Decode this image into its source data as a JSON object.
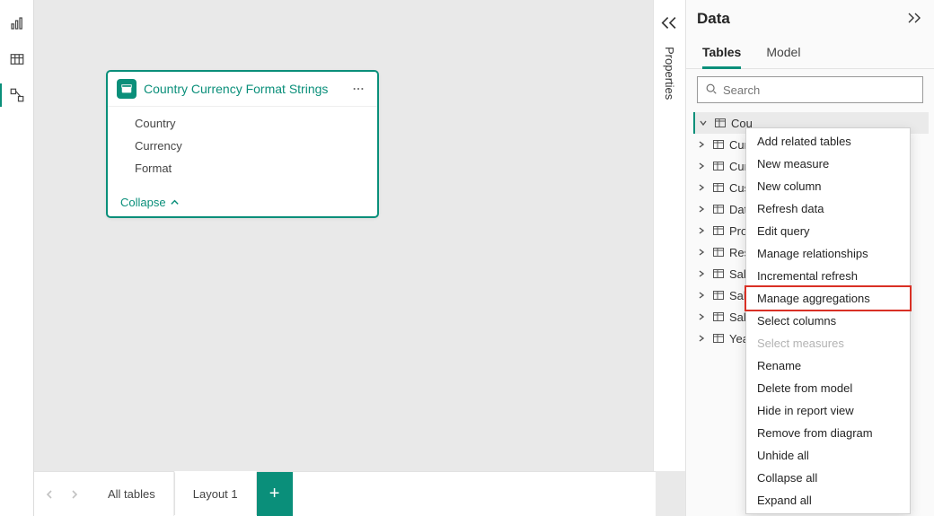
{
  "properties_pane": {
    "label": "Properties"
  },
  "table_card": {
    "title": "Country Currency Format Strings",
    "fields": [
      "Country",
      "Currency",
      "Format"
    ],
    "collapse_label": "Collapse"
  },
  "data_pane": {
    "title": "Data",
    "tabs": {
      "tables": "Tables",
      "model": "Model"
    },
    "search_placeholder": "Search",
    "tables": [
      {
        "label": "Cou",
        "selected": true
      },
      {
        "label": "Cur"
      },
      {
        "label": "Cur"
      },
      {
        "label": "Cus"
      },
      {
        "label": "Dat"
      },
      {
        "label": "Pro"
      },
      {
        "label": "Res"
      },
      {
        "label": "Sal"
      },
      {
        "label": "Sal"
      },
      {
        "label": "Sal"
      },
      {
        "label": "Yea"
      }
    ]
  },
  "context_menu": {
    "items": [
      "Add related tables",
      "New measure",
      "New column",
      "Refresh data",
      "Edit query",
      "Manage relationships",
      "Incremental refresh"
    ],
    "highlighted": "Manage aggregations",
    "items_after": [
      {
        "label": "Select columns"
      },
      {
        "label": "Select measures",
        "disabled": true
      },
      {
        "label": "Rename"
      },
      {
        "label": "Delete from model"
      },
      {
        "label": "Hide in report view"
      },
      {
        "label": "Remove from diagram"
      },
      {
        "label": "Unhide all"
      },
      {
        "label": "Collapse all"
      },
      {
        "label": "Expand all"
      }
    ]
  },
  "bottom_bar": {
    "all_tables": "All tables",
    "layout_tab": "Layout 1"
  }
}
